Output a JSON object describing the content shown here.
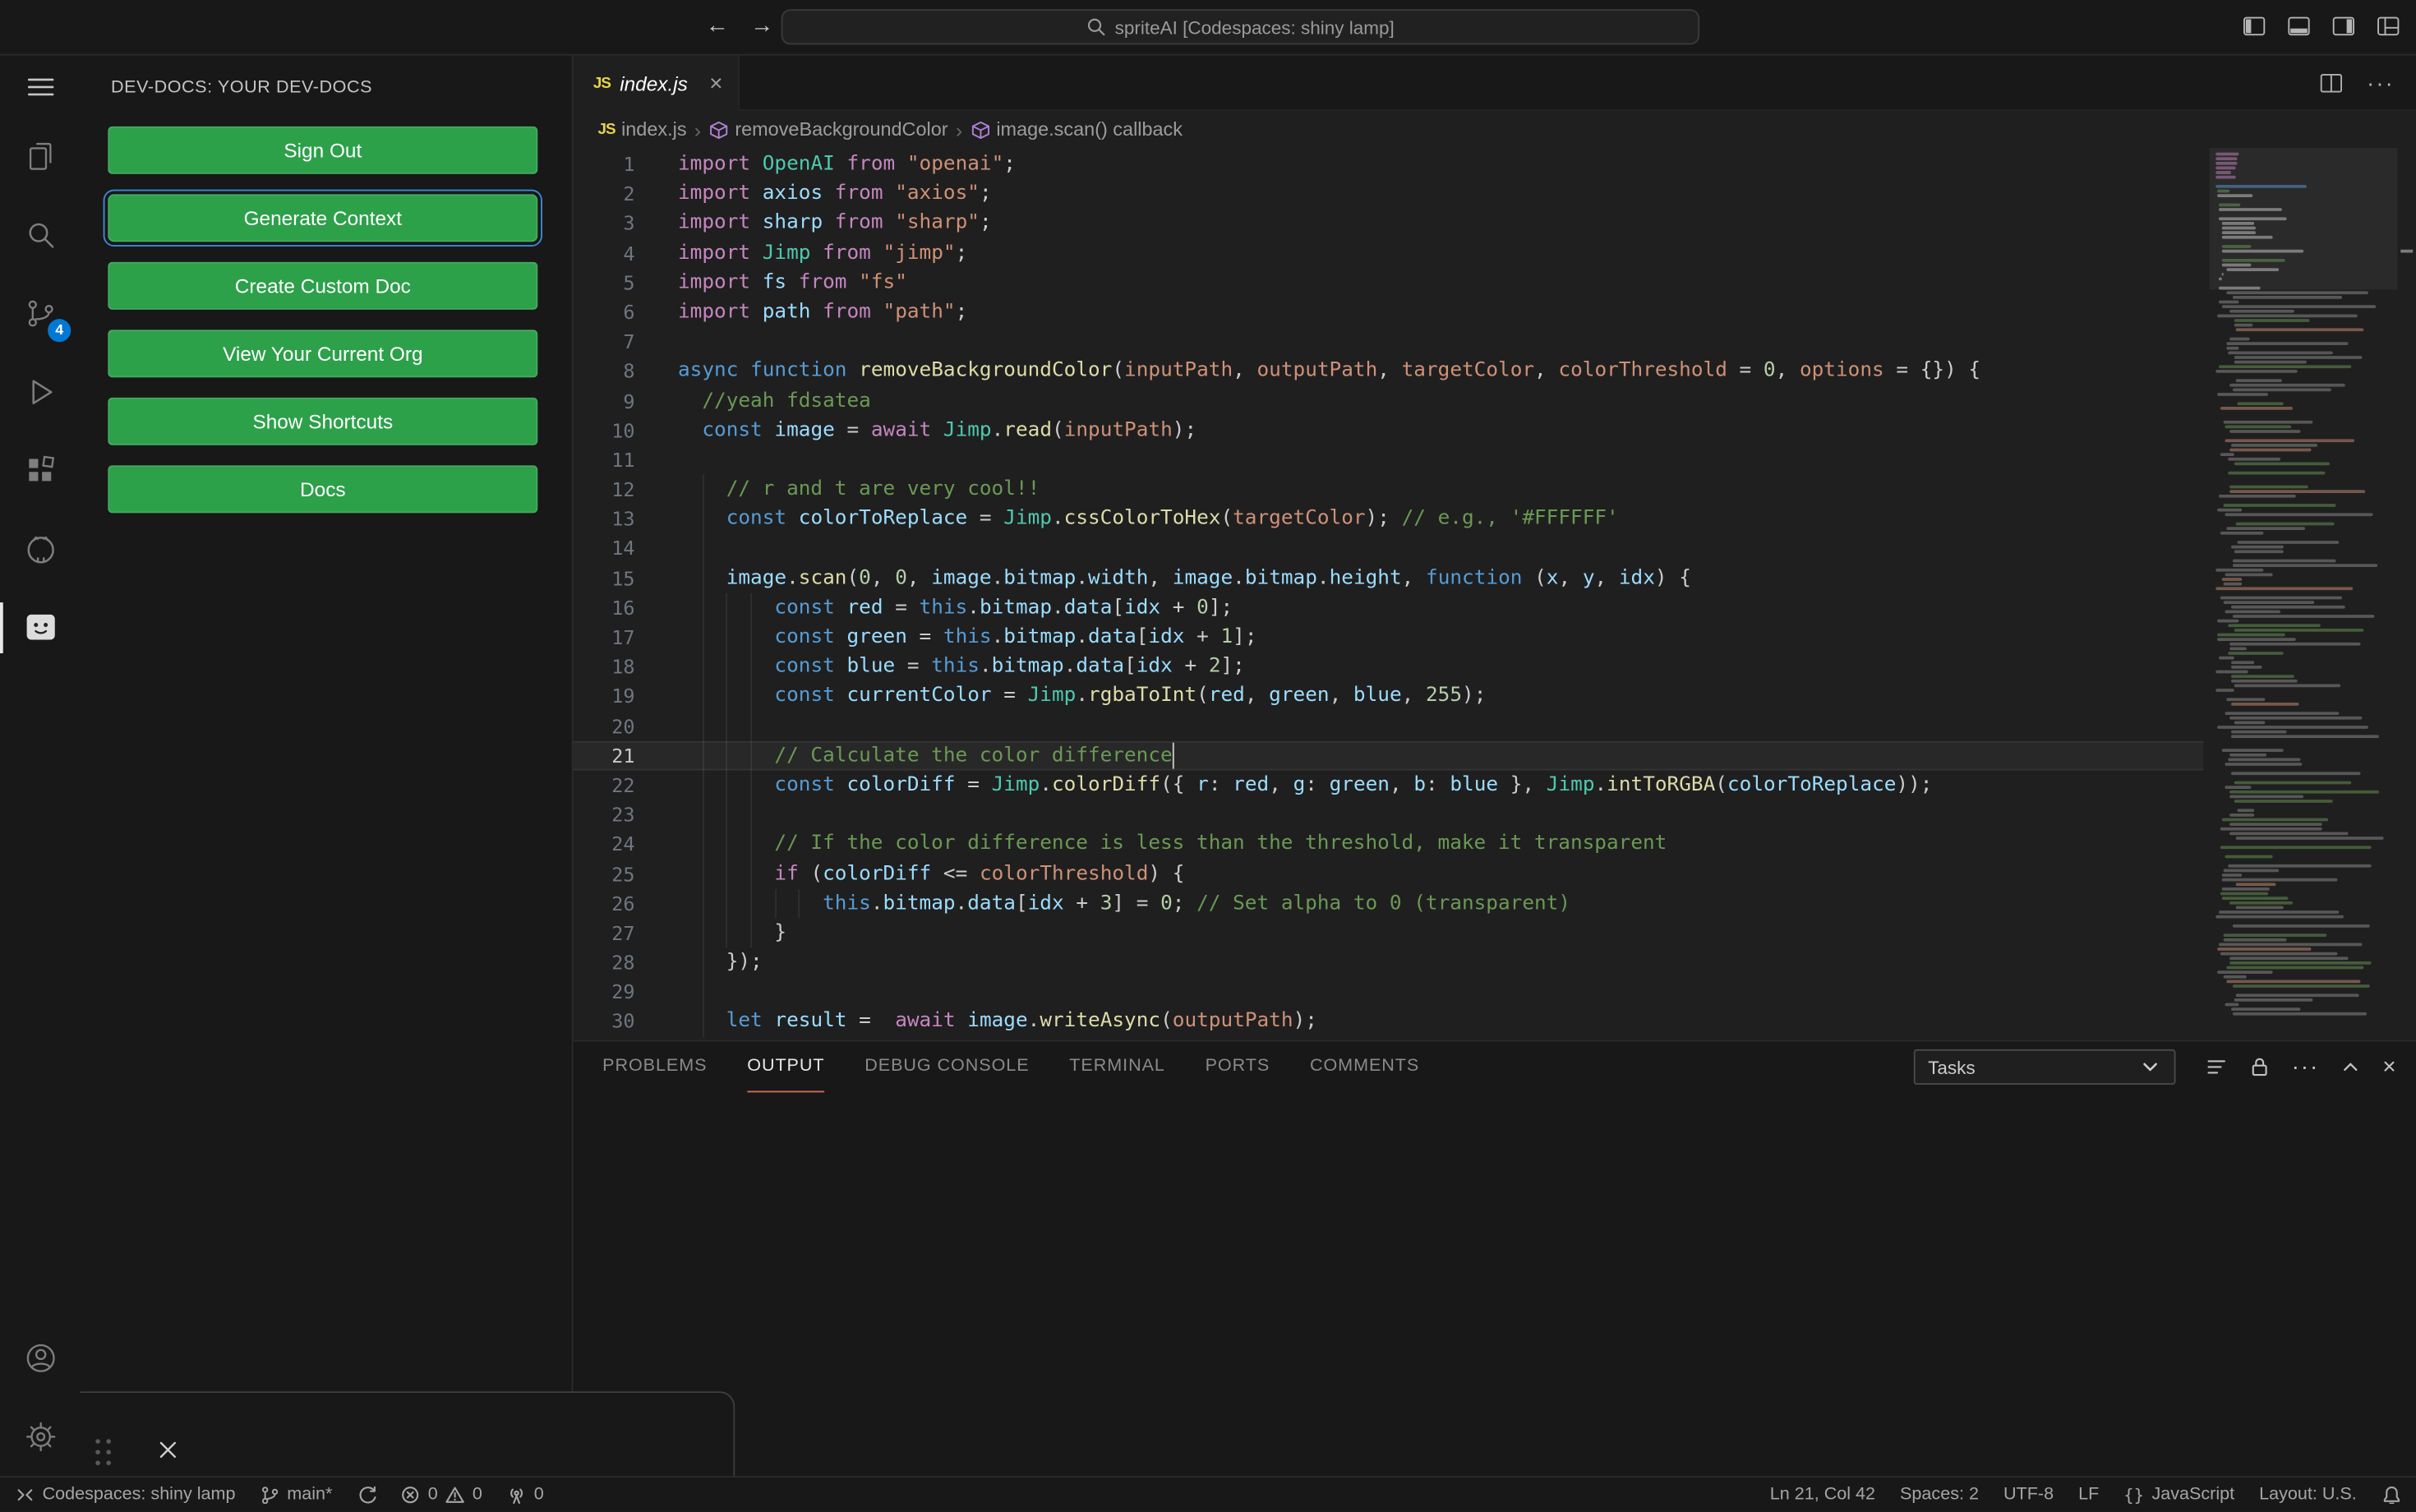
{
  "colors": {
    "button_green": "#2da04a",
    "focus_border_blue": "#3c88d8",
    "scm_badge_blue": "#0078d4",
    "panel_active_underline": "#cf6d57",
    "editor_background": "#1f1f1f",
    "shell_background": "#181818",
    "syntax": {
      "keyword": "#C586C0",
      "storage": "#569CD6",
      "function": "#DCDCAA",
      "variable": "#9CDCFE",
      "parameter": "#CE9178",
      "string": "#CE9178",
      "number": "#B5CEA8",
      "comment": "#6A9955",
      "class": "#4EC9B0",
      "punctuation": "#CCCCCC"
    }
  },
  "icons": {
    "back": "←",
    "forward": "→",
    "close": "×",
    "more": "···",
    "crumb_sep": "›",
    "braces": "{}"
  },
  "title_bar": {
    "search_label": "spriteAI [Codespaces: shiny lamp]"
  },
  "activity_bar": {
    "scm_badge": "4"
  },
  "sidebar": {
    "title": "DEV-DOCS: YOUR DEV-DOCS",
    "buttons": [
      {
        "label": "Sign Out",
        "focused": false
      },
      {
        "label": "Generate Context",
        "focused": true
      },
      {
        "label": "Create Custom Doc",
        "focused": false
      },
      {
        "label": "View Your Current Org",
        "focused": false
      },
      {
        "label": "Show Shortcuts",
        "focused": false
      },
      {
        "label": "Docs",
        "focused": false
      }
    ]
  },
  "editor": {
    "tab": {
      "label": "index.js",
      "icon_text": "JS"
    },
    "breadcrumbs": [
      {
        "label": "index.js"
      },
      {
        "label": "removeBackgroundColor"
      },
      {
        "label": "image.scan() callback"
      }
    ],
    "active_line": 21,
    "cursor_col": 42,
    "lines": [
      {
        "n": 1,
        "t": [
          [
            "kw",
            "import "
          ],
          [
            "cls",
            "OpenAI "
          ],
          [
            "kw",
            "from "
          ],
          [
            "str",
            "\"openai\""
          ],
          [
            "pln",
            ";"
          ]
        ]
      },
      {
        "n": 2,
        "t": [
          [
            "kw",
            "import "
          ],
          [
            "var",
            "axios "
          ],
          [
            "kw",
            "from "
          ],
          [
            "str",
            "\"axios\""
          ],
          [
            "pln",
            ";"
          ]
        ]
      },
      {
        "n": 3,
        "t": [
          [
            "kw",
            "import "
          ],
          [
            "var",
            "sharp "
          ],
          [
            "kw",
            "from "
          ],
          [
            "str",
            "\"sharp\""
          ],
          [
            "pln",
            ";"
          ]
        ]
      },
      {
        "n": 4,
        "t": [
          [
            "kw",
            "import "
          ],
          [
            "cls",
            "Jimp "
          ],
          [
            "kw",
            "from "
          ],
          [
            "str",
            "\"jimp\""
          ],
          [
            "pln",
            ";"
          ]
        ]
      },
      {
        "n": 5,
        "t": [
          [
            "kw",
            "import "
          ],
          [
            "var",
            "fs "
          ],
          [
            "kw",
            "from "
          ],
          [
            "str",
            "\"fs\""
          ]
        ]
      },
      {
        "n": 6,
        "t": [
          [
            "kw",
            "import "
          ],
          [
            "var",
            "path "
          ],
          [
            "kw",
            "from "
          ],
          [
            "str",
            "\"path\""
          ],
          [
            "pln",
            ";"
          ]
        ]
      },
      {
        "n": 7,
        "t": []
      },
      {
        "n": 8,
        "t": [
          [
            "decl",
            "async "
          ],
          [
            "decl",
            "function "
          ],
          [
            "fn",
            "removeBackgroundColor"
          ],
          [
            "pln",
            "("
          ],
          [
            "prm",
            "inputPath"
          ],
          [
            "pln",
            ", "
          ],
          [
            "prm",
            "outputPath"
          ],
          [
            "pln",
            ", "
          ],
          [
            "prm",
            "targetColor"
          ],
          [
            "pln",
            ", "
          ],
          [
            "prm",
            "colorThreshold"
          ],
          [
            "op",
            " = "
          ],
          [
            "num",
            "0"
          ],
          [
            "pln",
            ", "
          ],
          [
            "prm",
            "options"
          ],
          [
            "op",
            " = "
          ],
          [
            "pln",
            "{}) {"
          ]
        ]
      },
      {
        "n": 9,
        "t": [
          [
            "cmt",
            "  //yeah fdsatea"
          ]
        ]
      },
      {
        "n": 10,
        "t": [
          [
            "pln",
            "  "
          ],
          [
            "decl",
            "const "
          ],
          [
            "var",
            "image"
          ],
          [
            "op",
            " = "
          ],
          [
            "kw",
            "await "
          ],
          [
            "cls",
            "Jimp"
          ],
          [
            "pln",
            "."
          ],
          [
            "fn",
            "read"
          ],
          [
            "pln",
            "("
          ],
          [
            "prm",
            "inputPath"
          ],
          [
            "pln",
            ");"
          ]
        ]
      },
      {
        "n": 11,
        "t": []
      },
      {
        "n": 12,
        "t": [
          [
            "cmt",
            "    // r and t are very cool!!"
          ]
        ]
      },
      {
        "n": 13,
        "t": [
          [
            "pln",
            "    "
          ],
          [
            "decl",
            "const "
          ],
          [
            "var",
            "colorToReplace"
          ],
          [
            "op",
            " = "
          ],
          [
            "cls",
            "Jimp"
          ],
          [
            "pln",
            "."
          ],
          [
            "fn",
            "cssColorToHex"
          ],
          [
            "pln",
            "("
          ],
          [
            "prm",
            "targetColor"
          ],
          [
            "pln",
            ");"
          ],
          [
            "cmt",
            " // e.g., '#FFFFFF'"
          ]
        ]
      },
      {
        "n": 14,
        "t": []
      },
      {
        "n": 15,
        "t": [
          [
            "pln",
            "    "
          ],
          [
            "var",
            "image"
          ],
          [
            "pln",
            "."
          ],
          [
            "fn",
            "scan"
          ],
          [
            "pln",
            "("
          ],
          [
            "num",
            "0"
          ],
          [
            "pln",
            ", "
          ],
          [
            "num",
            "0"
          ],
          [
            "pln",
            ", "
          ],
          [
            "var",
            "image"
          ],
          [
            "pln",
            "."
          ],
          [
            "var",
            "bitmap"
          ],
          [
            "pln",
            "."
          ],
          [
            "var",
            "width"
          ],
          [
            "pln",
            ", "
          ],
          [
            "var",
            "image"
          ],
          [
            "pln",
            "."
          ],
          [
            "var",
            "bitmap"
          ],
          [
            "pln",
            "."
          ],
          [
            "var",
            "height"
          ],
          [
            "pln",
            ", "
          ],
          [
            "decl",
            "function "
          ],
          [
            "pln",
            "("
          ],
          [
            "var",
            "x"
          ],
          [
            "pln",
            ", "
          ],
          [
            "var",
            "y"
          ],
          [
            "pln",
            ", "
          ],
          [
            "var",
            "idx"
          ],
          [
            "pln",
            ") {"
          ]
        ]
      },
      {
        "n": 16,
        "t": [
          [
            "pln",
            "        "
          ],
          [
            "decl",
            "const "
          ],
          [
            "var",
            "red"
          ],
          [
            "op",
            " = "
          ],
          [
            "decl",
            "this"
          ],
          [
            "pln",
            "."
          ],
          [
            "var",
            "bitmap"
          ],
          [
            "pln",
            "."
          ],
          [
            "var",
            "data"
          ],
          [
            "pln",
            "["
          ],
          [
            "var",
            "idx"
          ],
          [
            "op",
            " + "
          ],
          [
            "num",
            "0"
          ],
          [
            "pln",
            "];"
          ]
        ]
      },
      {
        "n": 17,
        "t": [
          [
            "pln",
            "        "
          ],
          [
            "decl",
            "const "
          ],
          [
            "var",
            "green"
          ],
          [
            "op",
            " = "
          ],
          [
            "decl",
            "this"
          ],
          [
            "pln",
            "."
          ],
          [
            "var",
            "bitmap"
          ],
          [
            "pln",
            "."
          ],
          [
            "var",
            "data"
          ],
          [
            "pln",
            "["
          ],
          [
            "var",
            "idx"
          ],
          [
            "op",
            " + "
          ],
          [
            "num",
            "1"
          ],
          [
            "pln",
            "];"
          ]
        ]
      },
      {
        "n": 18,
        "t": [
          [
            "pln",
            "        "
          ],
          [
            "decl",
            "const "
          ],
          [
            "var",
            "blue"
          ],
          [
            "op",
            " = "
          ],
          [
            "decl",
            "this"
          ],
          [
            "pln",
            "."
          ],
          [
            "var",
            "bitmap"
          ],
          [
            "pln",
            "."
          ],
          [
            "var",
            "data"
          ],
          [
            "pln",
            "["
          ],
          [
            "var",
            "idx"
          ],
          [
            "op",
            " + "
          ],
          [
            "num",
            "2"
          ],
          [
            "pln",
            "];"
          ]
        ]
      },
      {
        "n": 19,
        "t": [
          [
            "pln",
            "        "
          ],
          [
            "decl",
            "const "
          ],
          [
            "var",
            "currentColor"
          ],
          [
            "op",
            " = "
          ],
          [
            "cls",
            "Jimp"
          ],
          [
            "pln",
            "."
          ],
          [
            "fn",
            "rgbaToInt"
          ],
          [
            "pln",
            "("
          ],
          [
            "var",
            "red"
          ],
          [
            "pln",
            ", "
          ],
          [
            "var",
            "green"
          ],
          [
            "pln",
            ", "
          ],
          [
            "var",
            "blue"
          ],
          [
            "pln",
            ", "
          ],
          [
            "num",
            "255"
          ],
          [
            "pln",
            ");"
          ]
        ]
      },
      {
        "n": 20,
        "t": []
      },
      {
        "n": 21,
        "t": [
          [
            "cmt",
            "        // Calculate the color difference"
          ]
        ]
      },
      {
        "n": 22,
        "t": [
          [
            "pln",
            "        "
          ],
          [
            "decl",
            "const "
          ],
          [
            "var",
            "colorDiff"
          ],
          [
            "op",
            " = "
          ],
          [
            "cls",
            "Jimp"
          ],
          [
            "pln",
            "."
          ],
          [
            "fn",
            "colorDiff"
          ],
          [
            "pln",
            "({ "
          ],
          [
            "var",
            "r"
          ],
          [
            "pln",
            ": "
          ],
          [
            "var",
            "red"
          ],
          [
            "pln",
            ", "
          ],
          [
            "var",
            "g"
          ],
          [
            "pln",
            ": "
          ],
          [
            "var",
            "green"
          ],
          [
            "pln",
            ", "
          ],
          [
            "var",
            "b"
          ],
          [
            "pln",
            ": "
          ],
          [
            "var",
            "blue"
          ],
          [
            "pln",
            " }, "
          ],
          [
            "cls",
            "Jimp"
          ],
          [
            "pln",
            "."
          ],
          [
            "fn",
            "intToRGBA"
          ],
          [
            "pln",
            "("
          ],
          [
            "var",
            "colorToReplace"
          ],
          [
            "pln",
            "));"
          ]
        ]
      },
      {
        "n": 23,
        "t": []
      },
      {
        "n": 24,
        "t": [
          [
            "cmt",
            "        // If the color difference is less than the threshold, make it transparent"
          ]
        ]
      },
      {
        "n": 25,
        "t": [
          [
            "pln",
            "        "
          ],
          [
            "kw",
            "if "
          ],
          [
            "pln",
            "("
          ],
          [
            "var",
            "colorDiff"
          ],
          [
            "op",
            " <= "
          ],
          [
            "prm",
            "colorThreshold"
          ],
          [
            "pln",
            ") {"
          ]
        ]
      },
      {
        "n": 26,
        "t": [
          [
            "pln",
            "            "
          ],
          [
            "decl",
            "this"
          ],
          [
            "pln",
            "."
          ],
          [
            "var",
            "bitmap"
          ],
          [
            "pln",
            "."
          ],
          [
            "var",
            "data"
          ],
          [
            "pln",
            "["
          ],
          [
            "var",
            "idx"
          ],
          [
            "op",
            " + "
          ],
          [
            "num",
            "3"
          ],
          [
            "pln",
            "]"
          ],
          [
            "op",
            " = "
          ],
          [
            "num",
            "0"
          ],
          [
            "pln",
            ";"
          ],
          [
            "cmt",
            " // Set alpha to 0 (transparent)"
          ]
        ]
      },
      {
        "n": 27,
        "t": [
          [
            "pln",
            "        }"
          ]
        ]
      },
      {
        "n": 28,
        "t": [
          [
            "pln",
            "    });"
          ]
        ]
      },
      {
        "n": 29,
        "t": []
      },
      {
        "n": 30,
        "t": [
          [
            "pln",
            "    "
          ],
          [
            "decl",
            "let "
          ],
          [
            "var",
            "result"
          ],
          [
            "op",
            " =  "
          ],
          [
            "kw",
            "await "
          ],
          [
            "var",
            "image"
          ],
          [
            "pln",
            "."
          ],
          [
            "fn",
            "writeAsync"
          ],
          [
            "pln",
            "("
          ],
          [
            "prm",
            "outputPath"
          ],
          [
            "pln",
            ");"
          ]
        ]
      }
    ]
  },
  "panel": {
    "tabs": [
      {
        "label": "PROBLEMS",
        "active": false
      },
      {
        "label": "OUTPUT",
        "active": true
      },
      {
        "label": "DEBUG CONSOLE",
        "active": false
      },
      {
        "label": "TERMINAL",
        "active": false
      },
      {
        "label": "PORTS",
        "active": false
      },
      {
        "label": "COMMENTS",
        "active": false
      }
    ],
    "tasks_dropdown": "Tasks"
  },
  "status_bar": {
    "remote": "Codespaces: shiny lamp",
    "branch": "main*",
    "errors": "0",
    "warnings": "0",
    "ports": "0",
    "cursor": "Ln 21, Col 42",
    "indentation": "Spaces: 2",
    "encoding": "UTF-8",
    "eol": "LF",
    "language": "JavaScript",
    "keyboard_layout": "Layout: U.S."
  }
}
